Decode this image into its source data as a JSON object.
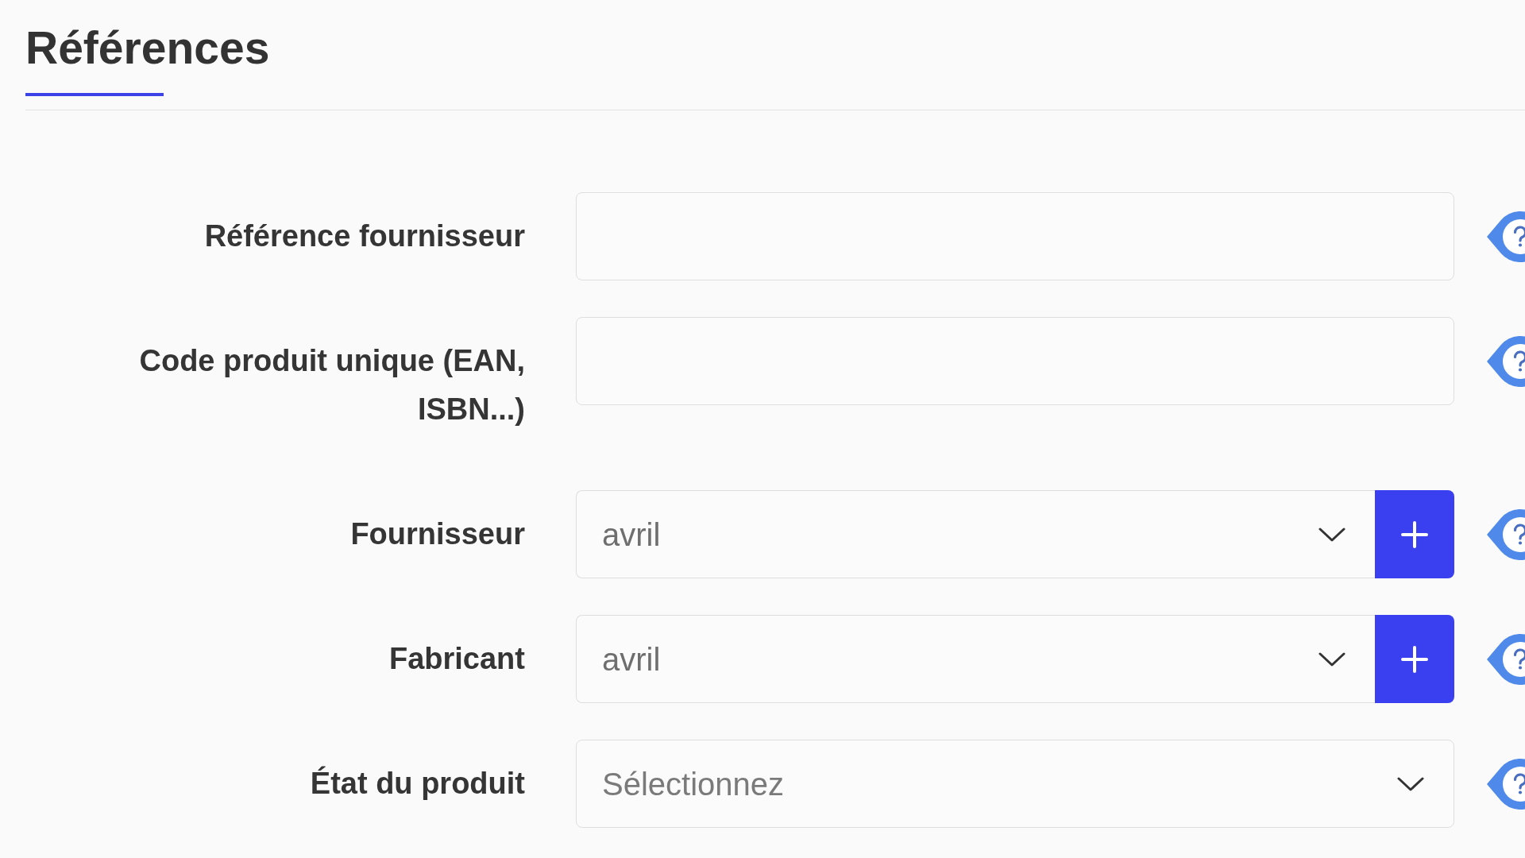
{
  "section": {
    "title": "Références"
  },
  "fields": [
    {
      "kind": "text",
      "label": "Référence fournisseur"
    },
    {
      "kind": "text",
      "label": "Code produit unique (EAN, ISBN...)"
    },
    {
      "kind": "select",
      "label": "Fournisseur",
      "value": "avril",
      "add_button": true
    },
    {
      "kind": "select",
      "label": "Fabricant",
      "value": "avril",
      "add_button": true
    },
    {
      "kind": "select",
      "label": "État du produit",
      "placeholder": "Sélectionnez",
      "add_button": false
    }
  ]
}
